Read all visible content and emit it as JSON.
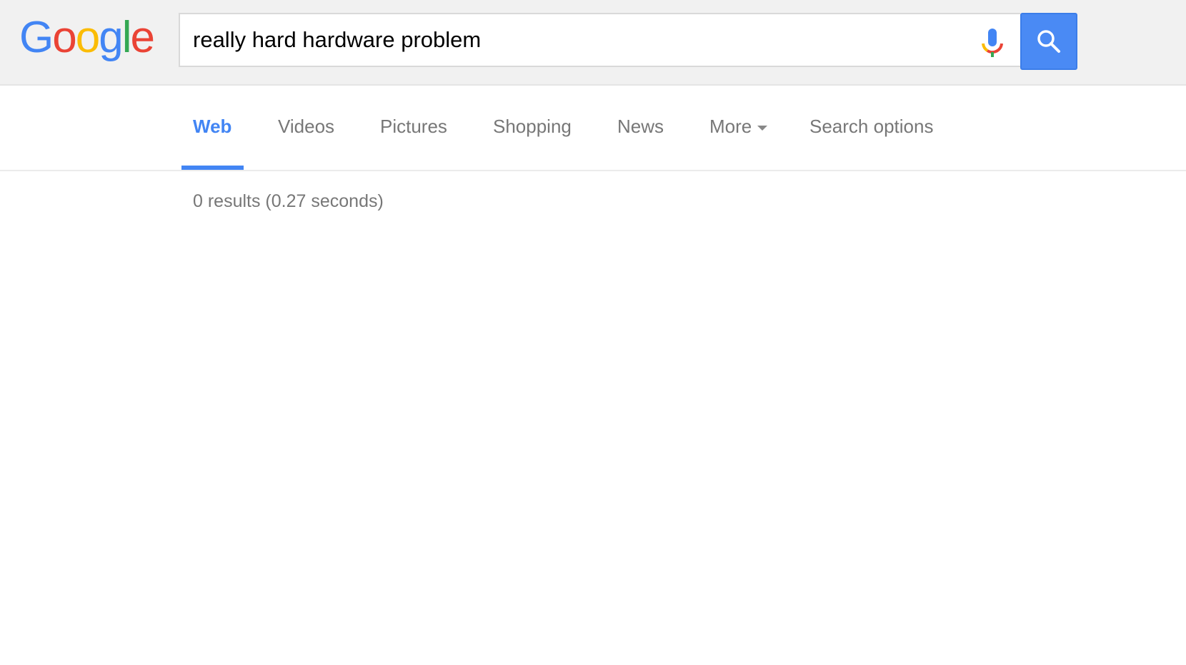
{
  "logo": {
    "letters": [
      "G",
      "o",
      "o",
      "g",
      "l",
      "e"
    ],
    "colors": [
      "#4285f4",
      "#ea4335",
      "#fbbc05",
      "#4285f4",
      "#34a853",
      "#ea4335"
    ]
  },
  "search": {
    "query": "really hard hardware problem",
    "mic_icon": "microphone-icon",
    "button_icon": "search-icon",
    "button_color": "#4a8af4"
  },
  "nav": {
    "tabs": [
      {
        "label": "Web",
        "active": true
      },
      {
        "label": "Videos"
      },
      {
        "label": "Pictures"
      },
      {
        "label": "Shopping"
      },
      {
        "label": "News"
      },
      {
        "label": "More"
      },
      {
        "label": "Search options"
      }
    ],
    "accent": "#4285f4"
  },
  "results": {
    "summary": "0 results (0.27 seconds)"
  }
}
